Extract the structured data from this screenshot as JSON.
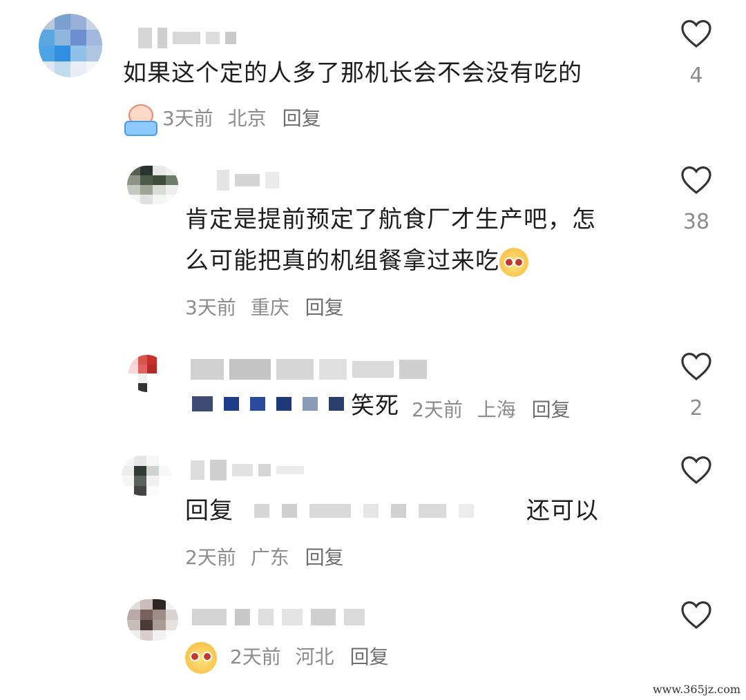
{
  "comments": [
    {
      "text": "如果这个定的人多了那机长会不会没有吃的",
      "time": "3天前",
      "location": "北京",
      "reply": "回复",
      "likes": "4",
      "emoji": "crying-sticker-icon"
    },
    {
      "text_line1": "肯定是提前预定了航食厂才生产吧，怎",
      "text_line2": "么可能把真的机组餐拿过来吃",
      "time": "3天前",
      "location": "重庆",
      "reply": "回复",
      "likes": "38",
      "emoji": "smiling-face-sticker-icon"
    },
    {
      "text": "笑死",
      "time": "2天前",
      "location": "上海",
      "reply": "回复",
      "likes": "2"
    },
    {
      "text_prefix": "回复",
      "text_suffix": "还可以",
      "time": "2天前",
      "location": "广东",
      "reply": "回复"
    },
    {
      "time": "2天前",
      "location": "河北",
      "reply": "回复",
      "emoji": "smiling-face-sticker-icon"
    }
  ],
  "icons": {
    "like": "heart-outline-icon"
  },
  "colors": {
    "text": "#1d1d1d",
    "meta": "#8c8c8c",
    "background": "#ffffff"
  },
  "watermark": "www.365jz.com"
}
